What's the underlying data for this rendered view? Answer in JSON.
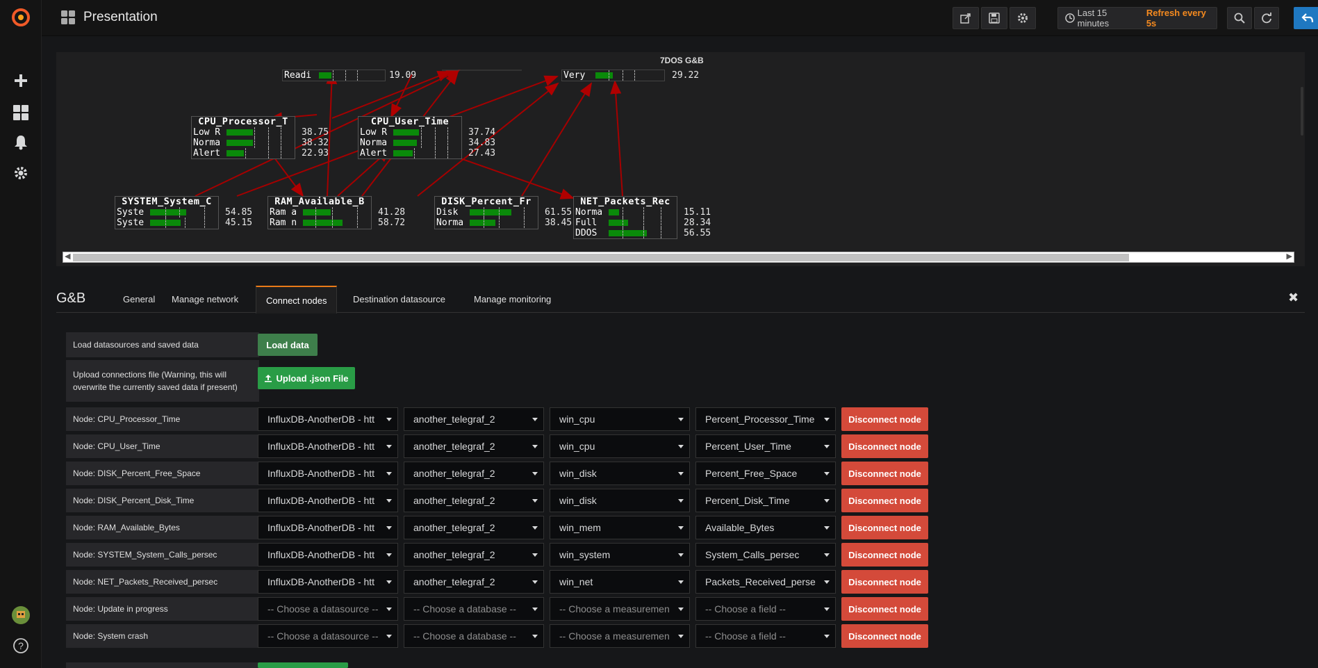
{
  "topbar": {
    "title": "Presentation",
    "time_range": "Last 15 minutes",
    "refresh": "Refresh every 5s"
  },
  "graph": {
    "top_label": "7DOS G&B",
    "nodes": [
      {
        "name": "readi",
        "title": "",
        "rows": [
          {
            "label": "Readi",
            "value": "19.09"
          }
        ]
      },
      {
        "name": "very",
        "title": "",
        "rows": [
          {
            "label": "Very",
            "value": "29.22"
          }
        ]
      },
      {
        "name": "cpu-processor",
        "title": "CPU_Processor_T",
        "rows": [
          {
            "label": "Low R",
            "value": "38.75"
          },
          {
            "label": "Norma",
            "value": "38.32"
          },
          {
            "label": "Alert",
            "value": "22.93"
          }
        ]
      },
      {
        "name": "cpu-user",
        "title": "CPU_User_Time",
        "rows": [
          {
            "label": "Low R",
            "value": "37.74"
          },
          {
            "label": "Norma",
            "value": "34.83"
          },
          {
            "label": "Alert",
            "value": "27.43"
          }
        ]
      },
      {
        "name": "system",
        "title": "SYSTEM_System_C",
        "rows": [
          {
            "label": "Syste",
            "value": "54.85"
          },
          {
            "label": "Syste",
            "value": "45.15"
          }
        ]
      },
      {
        "name": "ram",
        "title": "RAM_Available_B",
        "rows": [
          {
            "label": "Ram a",
            "value": "41.28"
          },
          {
            "label": "Ram n",
            "value": "58.72"
          }
        ]
      },
      {
        "name": "disk",
        "title": "DISK_Percent_Fr",
        "rows": [
          {
            "label": "Disk",
            "value": "61.55"
          },
          {
            "label": "Norma",
            "value": "38.45"
          }
        ]
      },
      {
        "name": "net",
        "title": "NET_Packets_Rec",
        "rows": [
          {
            "label": "Norma",
            "value": "15.11"
          },
          {
            "label": "Full",
            "value": "28.34"
          },
          {
            "label": "DDOS",
            "value": "56.55"
          }
        ]
      }
    ]
  },
  "editor": {
    "title": "G&B",
    "tabs": [
      "General",
      "Manage network",
      "Connect nodes",
      "Destination datasource",
      "Manage monitoring"
    ],
    "active_tab": "Connect nodes",
    "load_label": "Load datasources and saved data",
    "load_button": "Load data",
    "upload_label": "Upload connections file (Warning, this will overwrite the currently saved data if present)",
    "upload_button": "Upload .json File",
    "disconnect_label": "Disconnect node",
    "rows": [
      {
        "node": "Node: CPU_Processor_Time",
        "ds": "InfluxDB-AnotherDB - htt",
        "db": "another_telegraf_2",
        "m": "win_cpu",
        "f": "Percent_Processor_Time"
      },
      {
        "node": "Node: CPU_User_Time",
        "ds": "InfluxDB-AnotherDB - htt",
        "db": "another_telegraf_2",
        "m": "win_cpu",
        "f": "Percent_User_Time"
      },
      {
        "node": "Node: DISK_Percent_Free_Space",
        "ds": "InfluxDB-AnotherDB - htt",
        "db": "another_telegraf_2",
        "m": "win_disk",
        "f": "Percent_Free_Space"
      },
      {
        "node": "Node: DISK_Percent_Disk_Time",
        "ds": "InfluxDB-AnotherDB - htt",
        "db": "another_telegraf_2",
        "m": "win_disk",
        "f": "Percent_Disk_Time"
      },
      {
        "node": "Node: RAM_Available_Bytes",
        "ds": "InfluxDB-AnotherDB - htt",
        "db": "another_telegraf_2",
        "m": "win_mem",
        "f": "Available_Bytes"
      },
      {
        "node": "Node: SYSTEM_System_Calls_persec",
        "ds": "InfluxDB-AnotherDB - htt",
        "db": "another_telegraf_2",
        "m": "win_system",
        "f": "System_Calls_persec"
      },
      {
        "node": "Node: NET_Packets_Received_persec",
        "ds": "InfluxDB-AnotherDB - htt",
        "db": "another_telegraf_2",
        "m": "win_net",
        "f": "Packets_Received_perse"
      },
      {
        "node": "Node: Update in progress",
        "ds": "-- Choose a datasource --",
        "db": "-- Choose a database --",
        "m": "-- Choose a measuremen",
        "f": "-- Choose a field --"
      },
      {
        "node": "Node: System crash",
        "ds": "-- Choose a datasource --",
        "db": "-- Choose a database --",
        "m": "-- Choose a measuremen",
        "f": "-- Choose a field --"
      }
    ]
  },
  "colors": {
    "accent": "#eb7b18",
    "refresh": "#f58a1f",
    "danger": "#d44a3a",
    "success": "#299c46",
    "bar": "#0a8a0a",
    "edge": "#b00000"
  }
}
